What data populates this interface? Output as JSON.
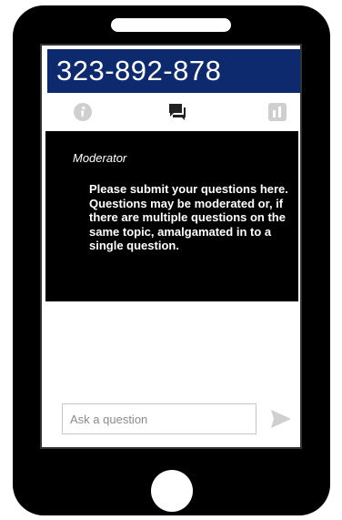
{
  "header": {
    "code": "323-892-878"
  },
  "tabs": [
    {
      "name": "info",
      "icon": "info-icon"
    },
    {
      "name": "chat",
      "icon": "chat-bubbles-icon"
    },
    {
      "name": "stats",
      "icon": "bar-chart-icon"
    }
  ],
  "chat": {
    "author": "Moderator",
    "message": "Please submit your questions here. Questions may be moderated or, if there are multiple questions on the same topic, amalgamated in to a single question."
  },
  "input": {
    "placeholder": "Ask a question",
    "value": ""
  },
  "send_icon": "send-arrow-icon",
  "colors": {
    "header_bg": "#0e2a6e",
    "phone_body": "#000000",
    "icon_gray": "#cfcfcf",
    "icon_dark": "#222222"
  }
}
